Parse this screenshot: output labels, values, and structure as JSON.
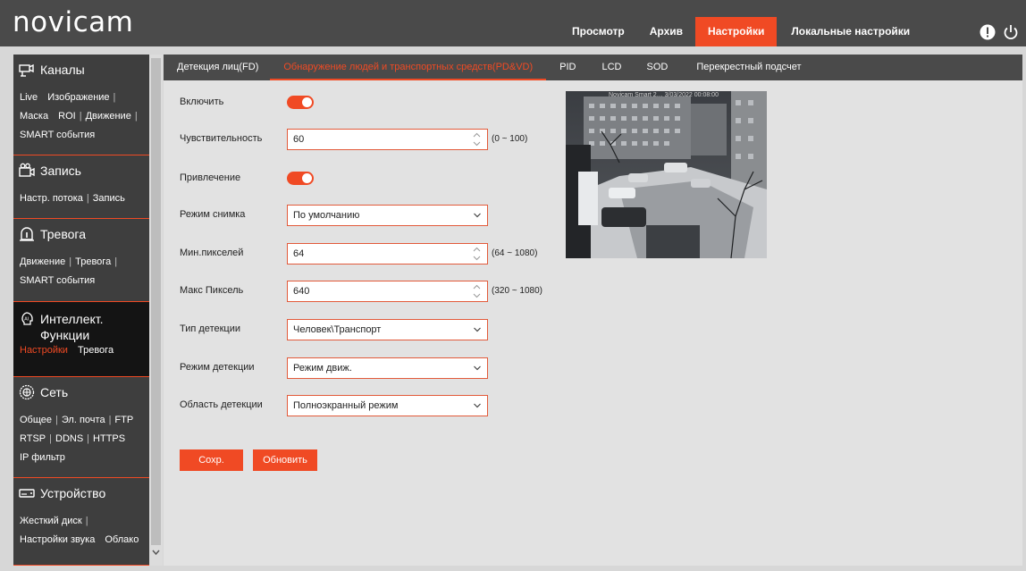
{
  "header": {
    "logo": "novicam",
    "nav": [
      {
        "label": "Просмотр"
      },
      {
        "label": "Архив"
      },
      {
        "label": "Настройки",
        "active": true
      },
      {
        "label": "Локальные настройки"
      }
    ]
  },
  "sidebar": {
    "groups": [
      {
        "title": "Каналы",
        "icon": "camera-channel-icon",
        "lines": [
          [
            "Live",
            "Изображение"
          ],
          [
            "Маска",
            "ROI",
            "Движение"
          ],
          [
            "SMART события"
          ]
        ]
      },
      {
        "title": "Запись",
        "icon": "recording-icon",
        "lines": [
          [
            "Настр. потока",
            "Запись"
          ]
        ]
      },
      {
        "title": "Тревога",
        "icon": "alarm-icon",
        "lines": [
          [
            "Движение",
            "Тревога"
          ],
          [
            "SMART события"
          ]
        ]
      },
      {
        "title": "Интеллект. Функции",
        "icon": "ai-icon",
        "active": true,
        "lines": [
          [
            "Настройки",
            "Тревога"
          ]
        ]
      },
      {
        "title": "Сеть",
        "icon": "network-icon",
        "lines": [
          [
            "Общее",
            "Эл. почта",
            "FTP"
          ],
          [
            "RTSP",
            "DDNS",
            "HTTPS"
          ],
          [
            "IP фильтр"
          ]
        ]
      },
      {
        "title": "Устройство",
        "icon": "device-icon",
        "lines": [
          [
            "Жесткий диск"
          ],
          [
            "Настройки звука",
            "Облако"
          ]
        ]
      }
    ]
  },
  "tabs": [
    {
      "label": "Детекция лиц(FD)"
    },
    {
      "label": "Обнаружение людей и транспортных средств(PD&VD)",
      "active": true
    },
    {
      "label": "PID"
    },
    {
      "label": "LCD"
    },
    {
      "label": "SOD"
    },
    {
      "label": "Перекрестный подсчет"
    }
  ],
  "form": {
    "enable": {
      "label": "Включить",
      "value": true
    },
    "sensitivity": {
      "label": "Чувствительность",
      "value": "60",
      "range": "(0 ~ 100)"
    },
    "attraction": {
      "label": "Привлечение",
      "value": true
    },
    "snapshot_mode": {
      "label": "Режим снимка",
      "value": "По умолчанию"
    },
    "min_pixels": {
      "label": "Мин.пикселей",
      "value": "64",
      "range": "(64 ~ 1080)"
    },
    "max_pixels": {
      "label": "Макс Пиксель",
      "value": "640",
      "range": "(320 ~ 1080)"
    },
    "detection_type": {
      "label": "Тип детекции",
      "value": "Человек\\Транспорт"
    },
    "detection_mode": {
      "label": "Режим детекции",
      "value": "Режим движ."
    },
    "detection_area": {
      "label": "Область детекции",
      "value": "Полноэкранный режим"
    }
  },
  "buttons": {
    "save": "Сохр.",
    "refresh": "Обновить"
  },
  "preview": {
    "overlay": "Novicam Smart 2…  3/03/2022 00:08:00"
  },
  "colors": {
    "accent": "#f04a24",
    "header": "#4a4a4a",
    "sidebar": "#3e3e3e",
    "sidebar_active": "#141414"
  }
}
